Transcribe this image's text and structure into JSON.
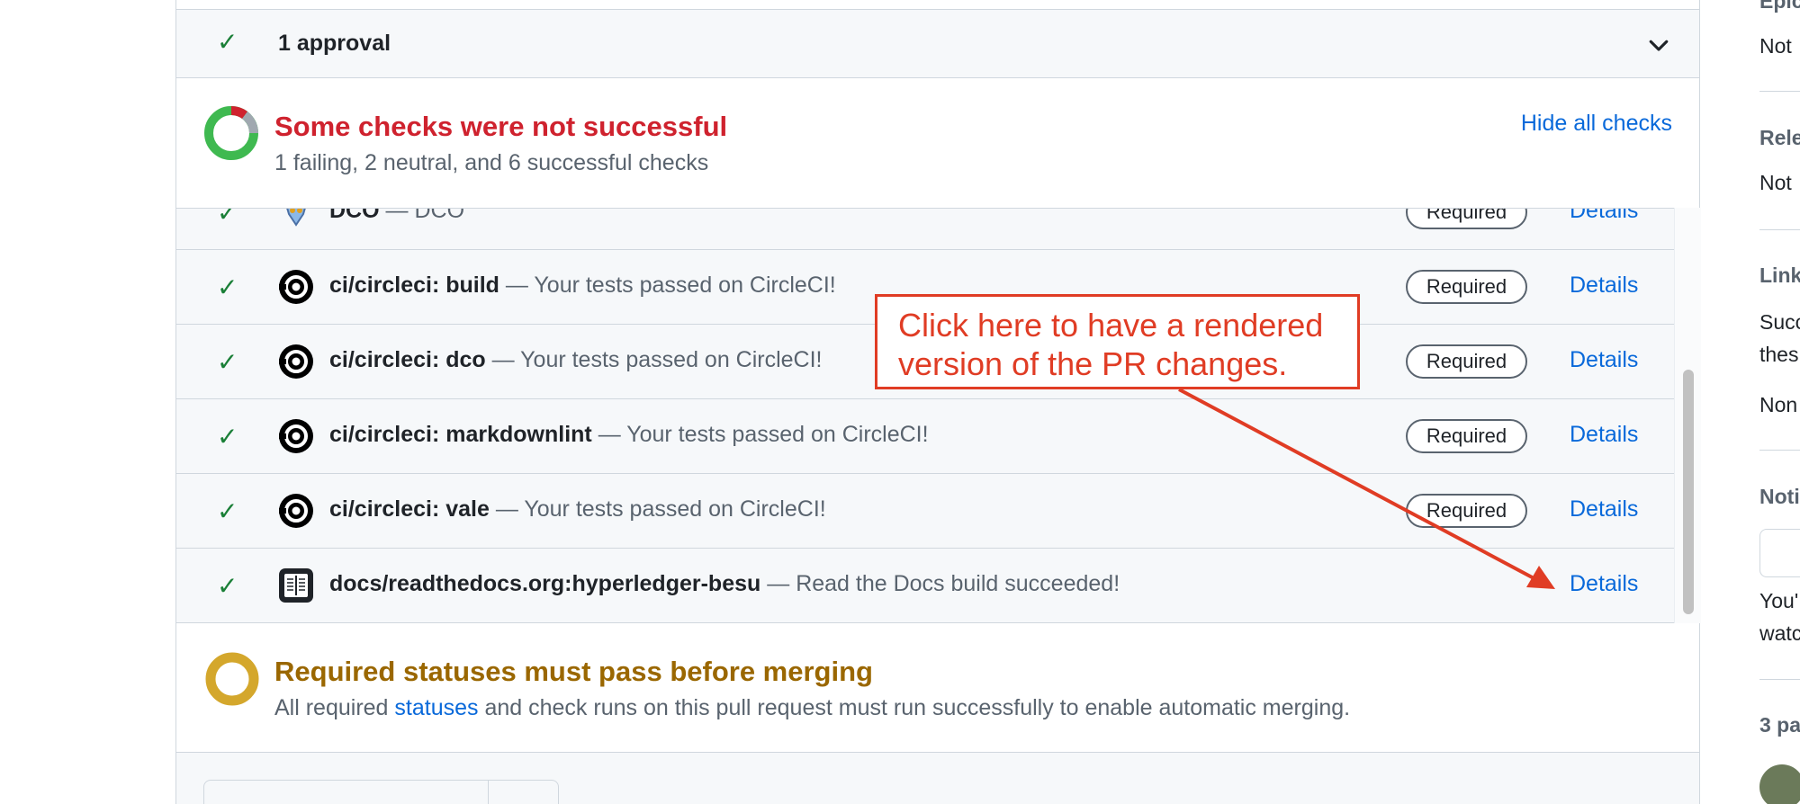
{
  "approval": {
    "label": "1 approval"
  },
  "summary": {
    "title": "Some checks were not successful",
    "subtitle": "1 failing, 2 neutral, and 6 successful checks",
    "hide_link": "Hide all checks"
  },
  "checks": [
    {
      "name": "DCO",
      "separator": " — ",
      "description": "DCO",
      "badge": "Required",
      "details": "Details",
      "icon": "dco-bot-icon"
    },
    {
      "name": "ci/circleci: build",
      "separator": " — ",
      "description": "Your tests passed on CircleCI!",
      "badge": "Required",
      "details": "Details",
      "icon": "circleci-icon"
    },
    {
      "name": "ci/circleci: dco",
      "separator": " — ",
      "description": "Your tests passed on CircleCI!",
      "badge": "Required",
      "details": "Details",
      "icon": "circleci-icon"
    },
    {
      "name": "ci/circleci: markdownlint",
      "separator": " — ",
      "description": "Your tests passed on CircleCI!",
      "badge": "Required",
      "details": "Details",
      "icon": "circleci-icon"
    },
    {
      "name": "ci/circleci: vale",
      "separator": " — ",
      "description": "Your tests passed on CircleCI!",
      "badge": "Required",
      "details": "Details",
      "icon": "circleci-icon"
    },
    {
      "name": "docs/readthedocs.org:hyperledger-besu",
      "separator": " — ",
      "description": "Read the Docs build succeeded!",
      "badge": "",
      "details": "Details",
      "icon": "readthedocs-icon"
    }
  ],
  "required_status": {
    "title": "Required statuses must pass before merging",
    "sub_before": "All required ",
    "sub_link": "statuses",
    "sub_after": " and check runs on this pull request must run successfully to enable automatic merging."
  },
  "sidebar": {
    "epic_heading": "Epic",
    "epic_value": "Not",
    "release_heading": "Rele",
    "release_value": "Not",
    "linked_heading": "Link",
    "linked_line1": "Succ",
    "linked_line2": "thes",
    "linked_none": "Non",
    "notif_heading": "Noti",
    "notif_line1": "You'",
    "notif_line2": "watc",
    "participants_heading": "3 pa"
  },
  "annotation": {
    "text_line1": "Click here to have a rendered",
    "text_line2": "version of the PR changes."
  },
  "colors": {
    "success": "#1a7f37",
    "danger": "#cf222e",
    "attention": "#9a6700",
    "link": "#0969da",
    "annotation": "#e03c24"
  }
}
